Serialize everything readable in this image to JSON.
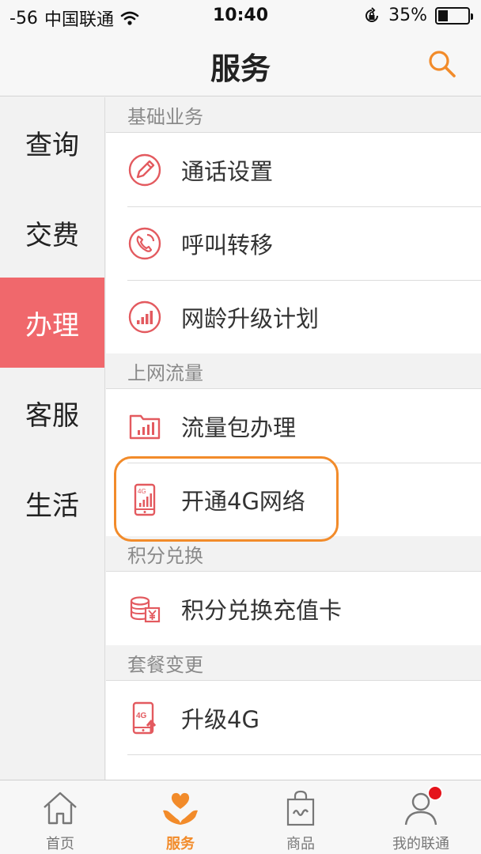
{
  "status_bar": {
    "signal": "-56",
    "carrier": "中国联通",
    "time": "10:40",
    "battery": "35%"
  },
  "header": {
    "title": "服务",
    "search_icon": "search-icon"
  },
  "sidebar": {
    "items": [
      {
        "label": "查询",
        "active": false
      },
      {
        "label": "交费",
        "active": false
      },
      {
        "label": "办理",
        "active": true
      },
      {
        "label": "客服",
        "active": false
      },
      {
        "label": "生活",
        "active": false
      }
    ]
  },
  "sections": [
    {
      "header": "基础业务",
      "items": [
        {
          "label": "通话设置",
          "icon": "pen-icon"
        },
        {
          "label": "呼叫转移",
          "icon": "phone-forward-icon"
        },
        {
          "label": "网龄升级计划",
          "icon": "signal-bars-icon"
        }
      ]
    },
    {
      "header": "上网流量",
      "items": [
        {
          "label": "流量包办理",
          "icon": "folder-chart-icon"
        },
        {
          "label": "开通4G网络",
          "icon": "phone-4g-icon"
        }
      ]
    },
    {
      "header": "积分兑换",
      "items": [
        {
          "label": "积分兑换充值卡",
          "icon": "coins-yen-icon"
        }
      ]
    },
    {
      "header": "套餐变更",
      "items": [
        {
          "label": "升级4G",
          "icon": "phone-4g-upgrade-icon"
        }
      ]
    }
  ],
  "tabbar": {
    "items": [
      {
        "label": "首页",
        "icon": "home-icon"
      },
      {
        "label": "服务",
        "icon": "heart-hands-icon"
      },
      {
        "label": "商品",
        "icon": "shopping-bag-icon"
      },
      {
        "label": "我的联通",
        "icon": "user-icon"
      }
    ]
  },
  "colors": {
    "accent": "#f0686c",
    "highlight": "#f28b2a",
    "icon": "#e35a5f"
  }
}
